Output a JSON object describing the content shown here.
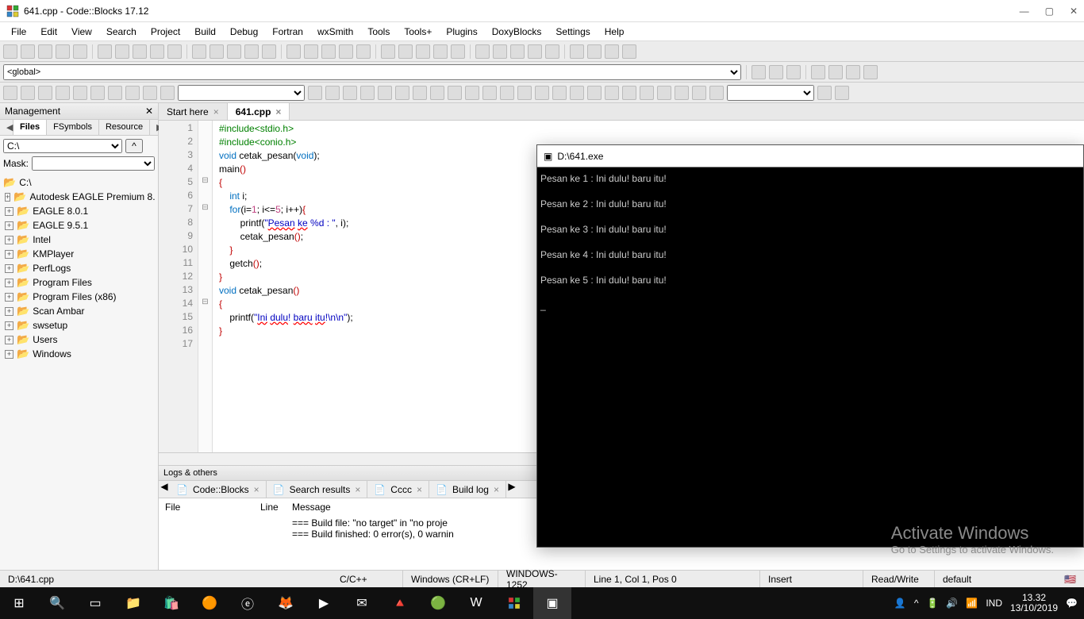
{
  "titlebar": {
    "title": "641.cpp - Code::Blocks 17.12"
  },
  "menu": [
    "File",
    "Edit",
    "View",
    "Search",
    "Project",
    "Build",
    "Debug",
    "Fortran",
    "wxSmith",
    "Tools",
    "Tools+",
    "Plugins",
    "DoxyBlocks",
    "Settings",
    "Help"
  ],
  "scope_selector": "<global>",
  "management": {
    "title": "Management",
    "tabs": [
      "Files",
      "FSymbols",
      "Resource"
    ],
    "active_tab": "Files",
    "drive": "C:\\",
    "mask_label": "Mask:",
    "tree": [
      {
        "label": "C:\\",
        "root": true
      },
      {
        "label": "Autodesk EAGLE Premium 8."
      },
      {
        "label": "EAGLE 8.0.1"
      },
      {
        "label": "EAGLE 9.5.1"
      },
      {
        "label": "Intel"
      },
      {
        "label": "KMPlayer"
      },
      {
        "label": "PerfLogs"
      },
      {
        "label": "Program Files"
      },
      {
        "label": "Program Files (x86)"
      },
      {
        "label": "Scan Ambar"
      },
      {
        "label": "swsetup"
      },
      {
        "label": "Users"
      },
      {
        "label": "Windows"
      }
    ]
  },
  "editor": {
    "tabs": [
      {
        "label": "Start here",
        "active": false
      },
      {
        "label": "641.cpp",
        "active": true
      }
    ],
    "lines": 17
  },
  "logs": {
    "title": "Logs & others",
    "tabs": [
      "Code::Blocks",
      "Search results",
      "Cccc",
      "Build log"
    ],
    "headers": {
      "file": "File",
      "line": "Line",
      "message": "Message"
    },
    "messages": [
      "=== Build file: \"no target\" in \"no proje",
      "=== Build finished: 0 error(s), 0 warnin"
    ]
  },
  "statusbar": {
    "path": "D:\\641.cpp",
    "lang": "C/C++",
    "eol": "Windows (CR+LF)",
    "enc": "WINDOWS-1252",
    "pos": "Line 1, Col 1, Pos 0",
    "ins": "Insert",
    "rw": "Read/Write",
    "profile": "default"
  },
  "console": {
    "title": "D:\\641.exe",
    "lines": [
      "Pesan ke 1 : Ini dulu! baru itu!",
      "",
      "Pesan ke 2 : Ini dulu! baru itu!",
      "",
      "Pesan ke 3 : Ini dulu! baru itu!",
      "",
      "Pesan ke 4 : Ini dulu! baru itu!",
      "",
      "Pesan ke 5 : Ini dulu! baru itu!",
      "",
      "_"
    ]
  },
  "watermark": {
    "big": "Activate Windows",
    "small": "Go to Settings to activate Windows."
  },
  "taskbar": {
    "time": "13.32",
    "date": "13/10/2019",
    "lang": "IND"
  }
}
